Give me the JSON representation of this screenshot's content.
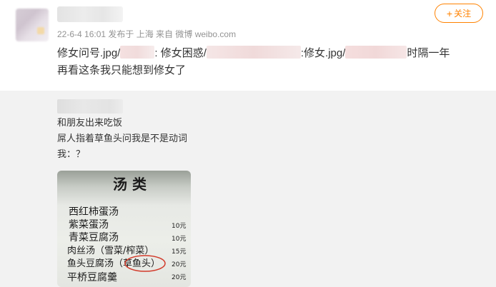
{
  "post": {
    "meta": "22-6-4 16:01 发布于 上海 来自 微博 weibo.com",
    "follow_label": "关注",
    "text_line1": {
      "a": "修女问号.jpg/",
      "b": ": 修女困惑/",
      "c": ":修女.jpg/",
      "d": "时隔一年"
    },
    "text_line2": "再看这条我只能想到修女了"
  },
  "repost": {
    "lines": [
      "和朋友出来吃饭",
      "屌人指着草鱼头问我是不是动词",
      "我：？"
    ]
  },
  "menu_photo": {
    "title": "汤  类",
    "items": [
      {
        "name": "西红柿蛋汤",
        "price": ""
      },
      {
        "name": "紫菜蛋汤",
        "price": "10元"
      },
      {
        "name": "青菜豆腐汤",
        "price": "10元"
      },
      {
        "name": "肉丝汤（雪菜/榨菜）",
        "price": "15元"
      },
      {
        "name": "鱼头豆腐汤（草鱼头）",
        "price": "20元"
      },
      {
        "name": "平桥豆腐羹",
        "price": "20元"
      }
    ]
  },
  "colors": {
    "accent": "#ff8200",
    "meta_gray": "#939393",
    "text": "#333333"
  }
}
